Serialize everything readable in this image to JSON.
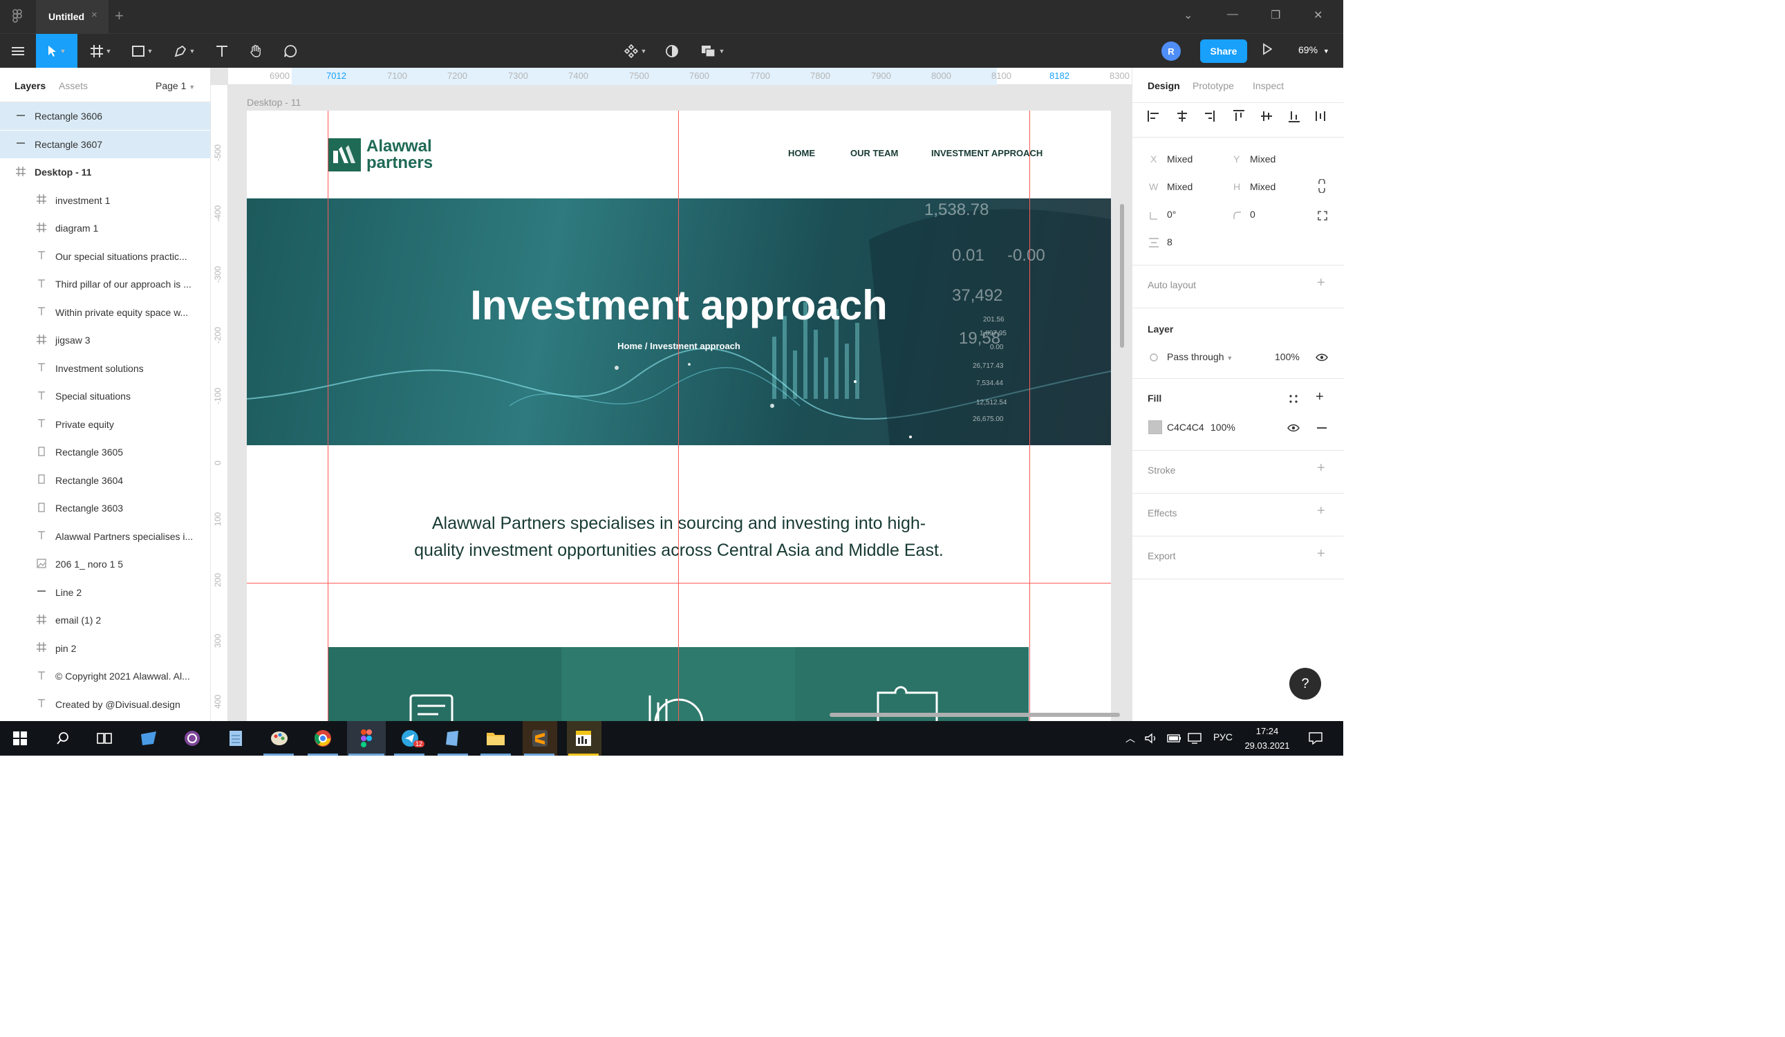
{
  "titlebar": {
    "tab_title": "Untitled",
    "close_glyph": "×",
    "add_glyph": "+",
    "win_controls": [
      "⌄",
      "—",
      "❐",
      "✕"
    ]
  },
  "toolbar": {
    "avatar_initial": "R",
    "share_label": "Share",
    "zoom_label": "69%"
  },
  "left_panel": {
    "tabs": [
      "Layers",
      "Assets"
    ],
    "page_label": "Page 1",
    "layers": [
      {
        "icon": "line",
        "name": "Rectangle 3606",
        "selected": true
      },
      {
        "icon": "line",
        "name": "Rectangle 3607",
        "selected": true
      },
      {
        "icon": "frame",
        "name": "Desktop - 11",
        "selected": false
      },
      {
        "icon": "frame",
        "name": "investment 1",
        "selected": false
      },
      {
        "icon": "frame",
        "name": "diagram 1",
        "selected": false
      },
      {
        "icon": "text",
        "name": "Our special situations practic...",
        "selected": false
      },
      {
        "icon": "text",
        "name": "Third pillar of our approach is ...",
        "selected": false
      },
      {
        "icon": "text",
        "name": "Within private equity space w...",
        "selected": false
      },
      {
        "icon": "frame",
        "name": "jigsaw 3",
        "selected": false
      },
      {
        "icon": "text",
        "name": "Investment solutions",
        "selected": false
      },
      {
        "icon": "text",
        "name": "Special situations",
        "selected": false
      },
      {
        "icon": "text",
        "name": "Private equity",
        "selected": false
      },
      {
        "icon": "rect",
        "name": "Rectangle 3605",
        "selected": false
      },
      {
        "icon": "rect",
        "name": "Rectangle 3604",
        "selected": false
      },
      {
        "icon": "rect",
        "name": "Rectangle 3603",
        "selected": false
      },
      {
        "icon": "text",
        "name": "Alawwal Partners specialises i...",
        "selected": false
      },
      {
        "icon": "image",
        "name": "206 1_ noro 1 5",
        "selected": false
      },
      {
        "icon": "line",
        "name": "Line 2",
        "selected": false
      },
      {
        "icon": "frame",
        "name": "email (1) 2",
        "selected": false
      },
      {
        "icon": "frame",
        "name": "pin 2",
        "selected": false
      },
      {
        "icon": "text",
        "name": "© Copyright 2021 Alawwal. Al...",
        "selected": false
      },
      {
        "icon": "text",
        "name": "Created by @Divisual.design",
        "selected": false
      }
    ]
  },
  "canvas": {
    "ruler_top": [
      "6900",
      "7012",
      "7100",
      "7200",
      "7300",
      "7400",
      "7500",
      "7600",
      "7700",
      "7800",
      "7900",
      "8000",
      "8100",
      "8182",
      "8300"
    ],
    "ruler_left": [
      "-500",
      "-400",
      "-300",
      "-200",
      "-100",
      "0",
      "100",
      "200",
      "300",
      "400"
    ],
    "frame_label": "Desktop - 11",
    "site": {
      "logo_line1": "Alawwal",
      "logo_line2": "partners",
      "nav": [
        "HOME",
        "OUR TEAM",
        "INVESTMENT APPROACH"
      ],
      "hero_title": "Investment approach",
      "hero_breadcrumb": "Home / Investment approach",
      "intro_text": "Alawwal Partners specialises in sourcing and investing into high-quality investment opportunities across Central Asia and Middle East."
    }
  },
  "right_panel": {
    "tabs": [
      "Design",
      "Prototype",
      "Inspect"
    ],
    "x_label": "X",
    "x_value": "Mixed",
    "y_label": "Y",
    "y_value": "Mixed",
    "w_label": "W",
    "w_value": "Mixed",
    "h_label": "H",
    "h_value": "Mixed",
    "rotation_value": "0°",
    "radius_value": "0",
    "spacing_value": "8",
    "auto_layout_label": "Auto layout",
    "layer_label": "Layer",
    "blend_mode": "Pass through",
    "layer_opacity": "100%",
    "fill_label": "Fill",
    "fill_hex": "C4C4C4",
    "fill_opacity": "100%",
    "stroke_label": "Stroke",
    "effects_label": "Effects",
    "export_label": "Export",
    "help_glyph": "?"
  },
  "taskbar": {
    "lang": "РУС",
    "time": "17:24",
    "date": "29.03.2021",
    "telegram_badge": "12"
  },
  "colors": {
    "accent": "#18a0fb",
    "brand_green": "#1f6a55",
    "guide": "#ff5a5a",
    "fill_swatch": "#c4c4c4"
  }
}
